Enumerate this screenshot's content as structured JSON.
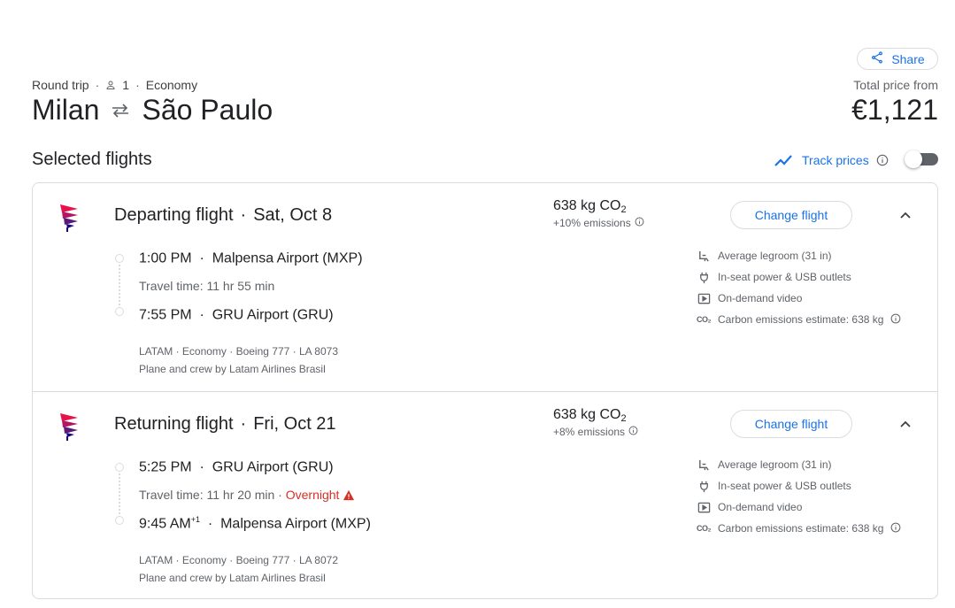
{
  "header": {
    "share_label": "Share",
    "trip_type": "Round trip",
    "passengers": "1",
    "cabin": "Economy",
    "origin": "Milan",
    "destination": "São Paulo",
    "total_label": "Total price from",
    "total_price": "€1,121"
  },
  "section_title": "Selected flights",
  "track_prices": {
    "label": "Track prices",
    "enabled": false
  },
  "flights": [
    {
      "title": "Departing flight",
      "date": "Sat, Oct 8",
      "co2": "638 kg CO",
      "co2_sub": "2",
      "emissions_pct": "+10% emissions",
      "change_label": "Change flight",
      "depart_time": "1:00 PM",
      "depart_sup": "",
      "depart_airport": "Malpensa Airport (MXP)",
      "travel_time": "Travel time: 11 hr 55 min",
      "overnight": "",
      "arrive_time": "7:55 PM",
      "arrive_sup": "",
      "arrive_airport": "GRU Airport (GRU)",
      "airline_line": "LATAM · Economy · Boeing 777 · LA 8073",
      "operator": "Plane and crew by Latam Airlines Brasil",
      "amenities": [
        "Average legroom (31 in)",
        "In-seat power & USB outlets",
        "On-demand video",
        "Carbon emissions estimate: 638 kg"
      ]
    },
    {
      "title": "Returning flight",
      "date": "Fri, Oct 21",
      "co2": "638 kg CO",
      "co2_sub": "2",
      "emissions_pct": "+8% emissions",
      "change_label": "Change flight",
      "depart_time": "5:25 PM",
      "depart_sup": "",
      "depart_airport": "GRU Airport (GRU)",
      "travel_time": "Travel time: 11 hr 20 min",
      "overnight": "Overnight",
      "arrive_time": "9:45 AM",
      "arrive_sup": "+1",
      "arrive_airport": "Malpensa Airport (MXP)",
      "airline_line": "LATAM · Economy · Boeing 777 · LA 8072",
      "operator": "Plane and crew by Latam Airlines Brasil",
      "amenities": [
        "Average legroom (31 in)",
        "In-seat power & USB outlets",
        "On-demand video",
        "Carbon emissions estimate: 638 kg"
      ]
    }
  ],
  "colors": {
    "accent": "#1a73e8",
    "warning": "#d93025",
    "border": "#dadce0",
    "muted": "#5f6368"
  },
  "icons": [
    "share-icon",
    "person-icon",
    "swap-arrows-icon",
    "trending-icon",
    "info-icon",
    "latam-logo",
    "chevron-up-icon",
    "legroom-icon",
    "power-plug-icon",
    "video-icon",
    "co2-icon",
    "warning-icon"
  ]
}
